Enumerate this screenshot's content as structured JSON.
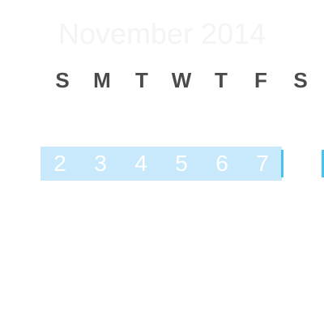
{
  "calendar": {
    "month_title": "November 2014",
    "weekdays": [
      "S",
      "M",
      "T",
      "W",
      "T",
      "F",
      "S"
    ],
    "week_days": [
      "2",
      "3",
      "4",
      "5",
      "6",
      "7"
    ]
  },
  "colors": {
    "week_band": "#c7e9fb",
    "accent": "#47c3ee",
    "weekday_text": "#4a4a4a",
    "day_text": "#ffffff",
    "title_text": "#f4f4f4"
  }
}
